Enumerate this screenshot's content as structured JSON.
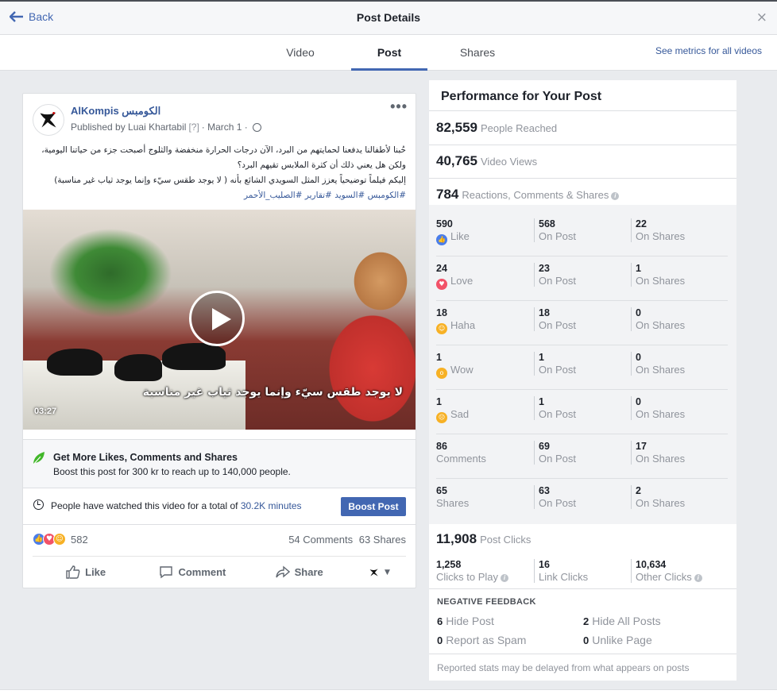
{
  "modal": {
    "back_label": "Back",
    "title": "Post Details",
    "close_glyph": "×"
  },
  "tabs": [
    {
      "label": "Video"
    },
    {
      "label": "Post"
    },
    {
      "label": "Shares"
    }
  ],
  "metrics_link": "See metrics for all videos",
  "post": {
    "page_name": "AlKompis الكومبس",
    "published_by": "Published by Luai Khartabil",
    "hint": "[?]",
    "date": "· March 1 ·",
    "text_line1": "حُبنا لأطفالنا يدفعنا لحمايتهم من البرد، الآن درجات الحرارة منخفضة والثلوج أصبحت جزء من حياتنا اليومية، ولكن هل يعني ذلك أن كثرة الملابس تقيهم البرد؟",
    "text_line2": "إليكم فيلماً توضيحياً يعزز المثل السويدي الشائع بأنه ( لا يوجد طقس سيّء وإنما يوجد ثياب غير مناسبة)",
    "hashtags": "#الكومبس #السويد #تقارير #الصليب_الأحمر",
    "video_caption": "لا يوجد طقس سيّء وإنما يوجد ثياب غير مناسبة",
    "video_duration": "03:27",
    "boost_title": "Get More Likes, Comments and Shares",
    "boost_desc": "Boost this post for 300 kr to reach up to 140,000 people.",
    "watch_text": "People have watched this video for a total of",
    "watch_minutes": "30.2K minutes",
    "boost_button": "Boost Post",
    "reaction_count": "582",
    "comments_count": "54 Comments",
    "shares_count": "63 Shares",
    "actions": {
      "like": "Like",
      "comment": "Comment",
      "share": "Share"
    }
  },
  "performance": {
    "title": "Performance for Your Post",
    "people_reached": {
      "value": "82,559",
      "label": "People Reached"
    },
    "video_views": {
      "value": "40,765",
      "label": "Video Views"
    },
    "rcs": {
      "value": "784",
      "label": "Reactions, Comments & Shares"
    },
    "rows": [
      {
        "total": "590",
        "label": "Like",
        "on_post": "568",
        "on_shares": "22",
        "icon": "like-icon",
        "color": "#4a7dea"
      },
      {
        "total": "24",
        "label": "Love",
        "on_post": "23",
        "on_shares": "1",
        "icon": "love-icon",
        "color": "#f25268"
      },
      {
        "total": "18",
        "label": "Haha",
        "on_post": "18",
        "on_shares": "0",
        "icon": "haha-icon",
        "color": "#f7b125"
      },
      {
        "total": "1",
        "label": "Wow",
        "on_post": "1",
        "on_shares": "0",
        "icon": "wow-icon",
        "color": "#f7b125"
      },
      {
        "total": "1",
        "label": "Sad",
        "on_post": "1",
        "on_shares": "0",
        "icon": "sad-icon",
        "color": "#f7b125"
      },
      {
        "total": "86",
        "label": "Comments",
        "on_post": "69",
        "on_shares": "17",
        "icon": "",
        "color": ""
      },
      {
        "total": "65",
        "label": "Shares",
        "on_post": "63",
        "on_shares": "2",
        "icon": "",
        "color": ""
      }
    ],
    "on_post_label": "On Post",
    "on_shares_label": "On Shares",
    "post_clicks": {
      "value": "11,908",
      "label": "Post Clicks"
    },
    "clicks": [
      {
        "value": "1,258",
        "label": "Clicks to Play"
      },
      {
        "value": "16",
        "label": "Link Clicks"
      },
      {
        "value": "10,634",
        "label": "Other Clicks"
      }
    ],
    "negative_title": "NEGATIVE FEEDBACK",
    "negative": [
      {
        "value": "6",
        "label": "Hide Post"
      },
      {
        "value": "2",
        "label": "Hide All Posts"
      },
      {
        "value": "0",
        "label": "Report as Spam"
      },
      {
        "value": "0",
        "label": "Unlike Page"
      }
    ],
    "delay_note": "Reported stats may be delayed from what appears on posts"
  }
}
